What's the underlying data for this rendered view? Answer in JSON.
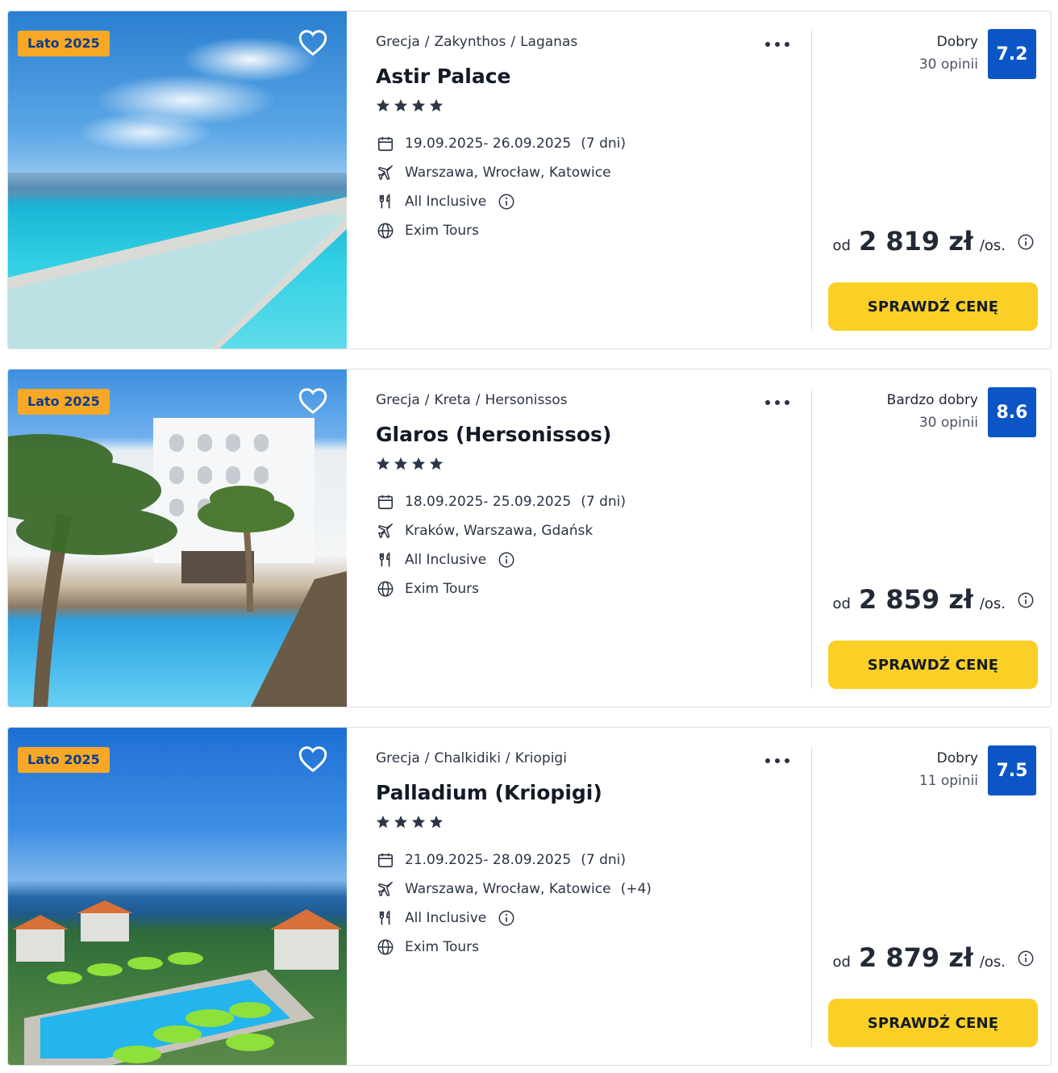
{
  "listings": [
    {
      "badge": "Lato 2025",
      "breadcrumb": [
        "Grecja",
        "Zakynthos",
        "Laganas"
      ],
      "name": "Astir Palace",
      "stars": 4,
      "dates": "19.09.2025- 26.09.2025",
      "duration": "(7 dni)",
      "departures": "Warszawa, Wrocław, Katowice",
      "departures_extra": "",
      "board": "All Inclusive",
      "operator": "Exim Tours",
      "rating_label": "Dobry",
      "rating_count": "30 opinii",
      "score": "7.2",
      "price_prefix": "od",
      "price": "2 819 zł",
      "price_unit": "/os.",
      "cta": "SPRAWDŹ CENĘ",
      "photo": "pool-sea",
      "favorite_icon": "heart-outline-icon"
    },
    {
      "badge": "Lato 2025",
      "breadcrumb": [
        "Grecja",
        "Kreta",
        "Hersonissos"
      ],
      "name": "Glaros (Hersonissos)",
      "stars": 4,
      "dates": "18.09.2025- 25.09.2025",
      "duration": "(7 dni)",
      "departures": "Kraków, Warszawa, Gdańsk",
      "departures_extra": "",
      "board": "All Inclusive",
      "operator": "Exim Tours",
      "rating_label": "Bardzo dobry",
      "rating_count": "30 opinii",
      "score": "8.6",
      "price_prefix": "od",
      "price": "2 859 zł",
      "price_unit": "/os.",
      "cta": "SPRAWDŹ CENĘ",
      "photo": "hotel-palms",
      "favorite_icon": "heart-outline-icon"
    },
    {
      "badge": "Lato 2025",
      "breadcrumb": [
        "Grecja",
        "Chalkidiki",
        "Kriopigi"
      ],
      "name": "Palladium (Kriopigi)",
      "stars": 4,
      "dates": "21.09.2025- 28.09.2025",
      "duration": "(7 dni)",
      "departures": "Warszawa, Wrocław, Katowice",
      "departures_extra": "(+4)",
      "board": "All Inclusive",
      "operator": "Exim Tours",
      "rating_label": "Dobry",
      "rating_count": "11 opinii",
      "score": "7.5",
      "price_prefix": "od",
      "price": "2 879 zł",
      "price_unit": "/os.",
      "cta": "SPRAWDŹ CENĘ",
      "photo": "resort-aerial",
      "favorite_icon": "heart-outline-icon"
    }
  ],
  "colors": {
    "badge_bg": "#f9a826",
    "badge_text": "#0c3c8c",
    "score_bg": "#0b55c6",
    "cta_bg": "#fbd026",
    "star": "#2b3648"
  }
}
